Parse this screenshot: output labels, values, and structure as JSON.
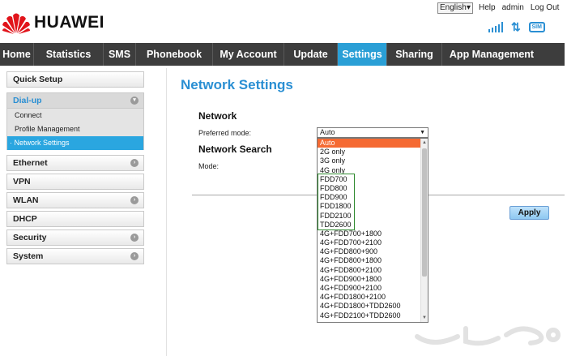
{
  "header": {
    "brand": "HUAWEI",
    "language": "English",
    "links": [
      "Help",
      "admin",
      "Log Out"
    ],
    "status_icons": [
      "signal-bars-icon",
      "data-transfer-arrows-icon",
      "sim-card-icon"
    ],
    "sim_label": "SIM"
  },
  "nav": {
    "items": [
      "Home",
      "Statistics",
      "SMS",
      "Phonebook",
      "My Account",
      "Update",
      "Settings",
      "Sharing",
      "App Management"
    ],
    "active": "Settings"
  },
  "sidebar": {
    "quick_setup": "Quick Setup",
    "dialup": "Dial-up",
    "dialup_items": [
      "Connect",
      "Profile Management",
      "Network Settings"
    ],
    "active_prefix": "·",
    "groups": [
      "Ethernet",
      "VPN",
      "WLAN",
      "DHCP",
      "Security",
      "System"
    ]
  },
  "content": {
    "title": "Network Settings",
    "network_heading": "Network",
    "preferred_mode_label": "Preferred mode:",
    "preferred_mode_value": "Auto",
    "network_search_heading": "Network Search",
    "mode_label": "Mode:",
    "apply_label": "Apply",
    "dropdown_options": [
      "Auto",
      "2G only",
      "3G only",
      "4G only",
      "FDD700",
      "FDD800",
      "FDD900",
      "FDD1800",
      "FDD2100",
      "TDD2600",
      "4G+FDD700+1800",
      "4G+FDD700+2100",
      "4G+FDD800+900",
      "4G+FDD800+1800",
      "4G+FDD800+2100",
      "4G+FDD900+1800",
      "4G+FDD900+2100",
      "4G+FDD1800+2100",
      "4G+FDD1800+TDD2600",
      "4G+FDD2100+TDD2600"
    ]
  },
  "colors": {
    "accent": "#2a9fd6",
    "nav_bg": "#3d3d3d",
    "selected_option": "#f56a33",
    "highlight_box": "#2f8a2f",
    "logo_red": "#e1141b"
  }
}
